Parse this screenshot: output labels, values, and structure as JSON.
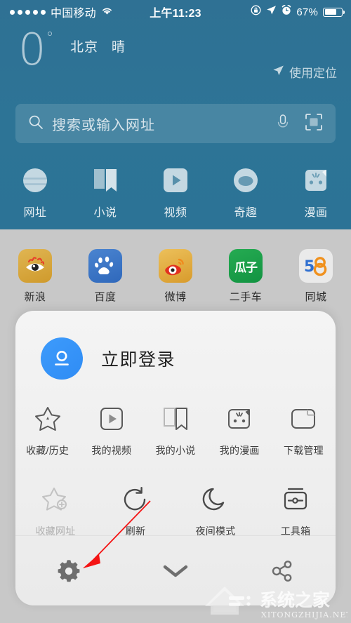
{
  "status_bar": {
    "signal_dots": 5,
    "carrier": "中国移动",
    "wifi_icon": "wifi-icon",
    "time": "上午11:23",
    "rotation_lock_icon": "rotation-lock-icon",
    "location_icon": "location-arrow-icon",
    "alarm_icon": "alarm-clock-icon",
    "battery_percent": "67%",
    "battery_level": 67
  },
  "weather": {
    "temperature": "0",
    "degree_symbol": "°",
    "city": "北京",
    "condition": "晴",
    "locate_label": "使用定位",
    "locate_icon": "location-arrow-icon"
  },
  "search": {
    "placeholder": "搜索或输入网址",
    "search_icon": "search-icon",
    "voice_icon": "microphone-icon",
    "scan_icon": "qr-scan-icon"
  },
  "shortcuts": [
    {
      "label": "网址",
      "icon": "globe-icon"
    },
    {
      "label": "小说",
      "icon": "book-icon"
    },
    {
      "label": "视频",
      "icon": "video-play-icon"
    },
    {
      "label": "奇趣",
      "icon": "fun-face-icon"
    },
    {
      "label": "漫画",
      "icon": "comic-face-icon"
    }
  ],
  "apps": [
    {
      "label": "新浪",
      "icon": "sina-icon",
      "color": "#d9a63a"
    },
    {
      "label": "百度",
      "icon": "baidu-icon",
      "color": "#3a72c4"
    },
    {
      "label": "微博",
      "icon": "weibo-icon",
      "color": "#e0ab38"
    },
    {
      "label": "二手车",
      "icon": "guazi-icon",
      "color": "#19a24a"
    },
    {
      "label": "同城",
      "icon": "tongcheng-icon",
      "color": "#e6e6e6"
    }
  ],
  "menu_panel": {
    "login": {
      "label": "立即登录",
      "avatar_icon": "user-avatar-icon"
    },
    "row1": [
      {
        "label": "收藏/历史",
        "icon": "star-icon",
        "disabled": false
      },
      {
        "label": "我的视频",
        "icon": "video-play-icon",
        "disabled": false
      },
      {
        "label": "我的小说",
        "icon": "book-icon",
        "disabled": false
      },
      {
        "label": "我的漫画",
        "icon": "comic-face-icon",
        "disabled": false
      },
      {
        "label": "下载管理",
        "icon": "download-folder-icon",
        "disabled": false
      }
    ],
    "row2": [
      {
        "label": "收藏网址",
        "icon": "star-plus-icon",
        "disabled": true
      },
      {
        "label": "刷新",
        "icon": "refresh-icon",
        "disabled": false
      },
      {
        "label": "夜间模式",
        "icon": "moon-icon",
        "disabled": false
      },
      {
        "label": "工具箱",
        "icon": "toolbox-icon",
        "disabled": false
      }
    ],
    "bottom": [
      {
        "name": "settings-button",
        "icon": "gear-icon"
      },
      {
        "name": "collapse-button",
        "icon": "chevron-down-icon"
      },
      {
        "name": "share-button",
        "icon": "share-icon"
      }
    ]
  },
  "annotation": {
    "type": "red-arrow",
    "color": "#f41414",
    "points_to": "settings-button"
  },
  "watermark": {
    "text_cn": "系统之家",
    "text_en": "XITONGZHIJIA.NET"
  },
  "colors": {
    "header_teal": "#2d7496",
    "page_gray": "#c8c8c8",
    "panel_gray": "#f0f0f0",
    "accent_blue": "#3d9bfb",
    "annotation_red": "#f41414"
  }
}
